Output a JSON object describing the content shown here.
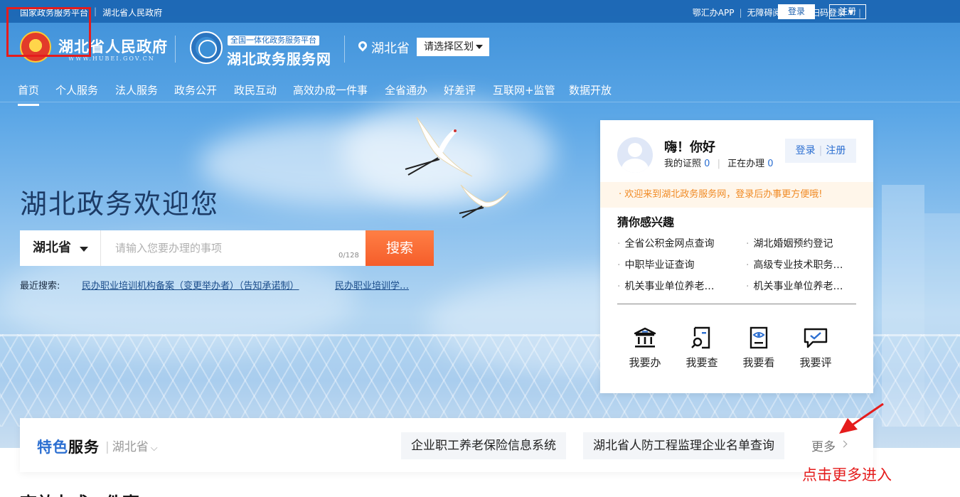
{
  "topbar": {
    "left_links": [
      "国家政务服务平台",
      "湖北省人民政府"
    ],
    "app_link": "鄂汇办APP",
    "accessibility": "无障碍阅读",
    "scan_login": "扫码登录",
    "login": "登录",
    "register": "注册"
  },
  "header": {
    "gov_title": "湖北省人民政府",
    "gov_url": "WWW.HUBEI.GOV.CN",
    "platform_tag": "全国一体化政务服务平台",
    "service_title": "湖北政务服务网",
    "location": "湖北省",
    "region_select": "请选择区划"
  },
  "nav": {
    "items": [
      "首页",
      "个人服务",
      "法人服务",
      "政务公开",
      "政民互动",
      "高效办成一件事",
      "全省通办",
      "好差评",
      "互联网+监管",
      "数据开放"
    ]
  },
  "hero": {
    "welcome": "湖北政务欢迎您",
    "search_region": "湖北省",
    "search_placeholder": "请输入您要办理的事项",
    "char_count": "0/128",
    "search_button": "搜索",
    "recent_label": "最近搜索:",
    "recent_items": [
      "民办职业培训机构备案（变更举办者）（告知承诺制）",
      "民办职业培训学…"
    ]
  },
  "user_panel": {
    "greeting": "嗨！你好",
    "certs_label": "我的证照",
    "certs_count": "0",
    "processing_label": "正在办理",
    "processing_count": "0",
    "login": "登录",
    "register": "注册",
    "notice": "· 欢迎来到湖北政务服务网，登录后办事更方便哦!",
    "interest_title": "猜你感兴趣",
    "interest_items": [
      "全省公积金网点查询",
      "湖北婚姻预约登记",
      "中职毕业证查询",
      "高级专业技术职务…",
      "机关事业单位养老…",
      "机关事业单位养老…"
    ],
    "actions": [
      {
        "label": "我要办",
        "icon": "bank-icon"
      },
      {
        "label": "我要查",
        "icon": "search-doc-icon"
      },
      {
        "label": "我要看",
        "icon": "view-doc-icon"
      },
      {
        "label": "我要评",
        "icon": "comment-icon"
      }
    ]
  },
  "special": {
    "title_accent": "特色",
    "title_rest": "服务",
    "region": "湖北省",
    "chips": [
      "企业职工养老保险信息系统",
      "湖北省人防工程监理企业名单查询"
    ],
    "more": "更多"
  },
  "annotation": {
    "hint": "点击更多进入"
  },
  "section": {
    "heading": "高效办成一件事"
  },
  "colors": {
    "topbar": "#1c67b4",
    "accent_blue": "#2c6fd1",
    "search_button": "#f55d2a",
    "notice_text": "#f08a24",
    "annotation_red": "#e51c1c"
  }
}
